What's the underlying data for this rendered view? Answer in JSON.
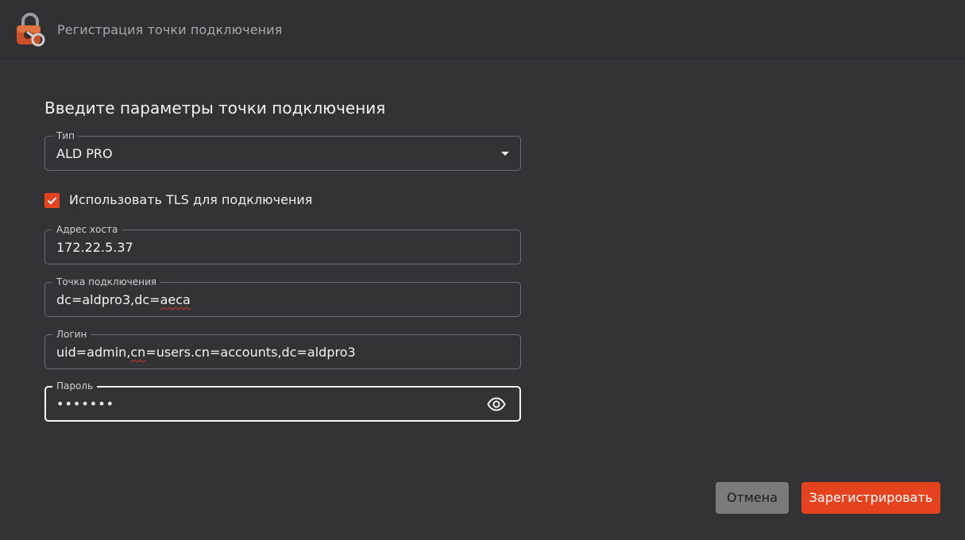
{
  "window": {
    "title": "Регистрация точки подключения",
    "icon": "lock-key-icon"
  },
  "form": {
    "heading": "Введите параметры точки подключения",
    "type": {
      "label": "Тип",
      "value": "ALD PRO"
    },
    "tls": {
      "label": "Использовать TLS для подключения",
      "checked": true
    },
    "host": {
      "label": "Адрес хоста",
      "value": "172.22.5.37"
    },
    "endpoint": {
      "label": "Точка подключения",
      "value_prefix": "dc=aldpro3,dc=",
      "value_suffix": "aeca"
    },
    "login": {
      "label": "Логин",
      "value_prefix": "uid=admin,",
      "value_misspelled": "cn",
      "value_suffix": "=users.cn=accounts,dc=aldpro3"
    },
    "password": {
      "label": "Пароль",
      "value": "•••••••",
      "toggle_icon": "eye-icon"
    }
  },
  "buttons": {
    "cancel": "Отмена",
    "register": "Зарегистрировать"
  },
  "colors": {
    "accent": "#e5431f",
    "background": "#333336",
    "cancel": "#7b7b7e"
  }
}
